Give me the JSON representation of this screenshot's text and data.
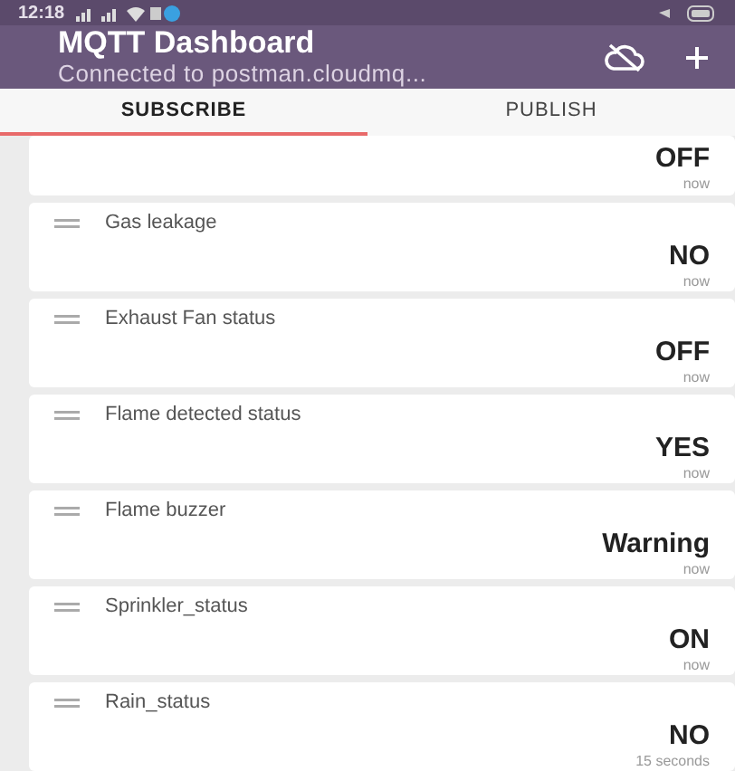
{
  "status_bar": {
    "time": "12:18"
  },
  "app_bar": {
    "title": "MQTT Dashboard",
    "subtitle": "Connected to postman.cloudmq..."
  },
  "tabs": [
    {
      "label": "SUBSCRIBE",
      "selected": true
    },
    {
      "label": "PUBLISH",
      "selected": false
    }
  ],
  "tiles": [
    {
      "value": "OFF",
      "time": "now"
    },
    {
      "name": "Gas leakage",
      "value": "NO",
      "time": "now"
    },
    {
      "name": "Exhaust Fan status",
      "value": "OFF",
      "time": "now"
    },
    {
      "name": "Flame detected status",
      "value": "YES",
      "time": "now"
    },
    {
      "name": "Flame buzzer",
      "value": "Warning",
      "time": "now"
    },
    {
      "name": "Sprinkler_status",
      "value": "ON",
      "time": "now"
    },
    {
      "name": "Rain_status",
      "value": "NO",
      "time": "15 seconds"
    }
  ]
}
